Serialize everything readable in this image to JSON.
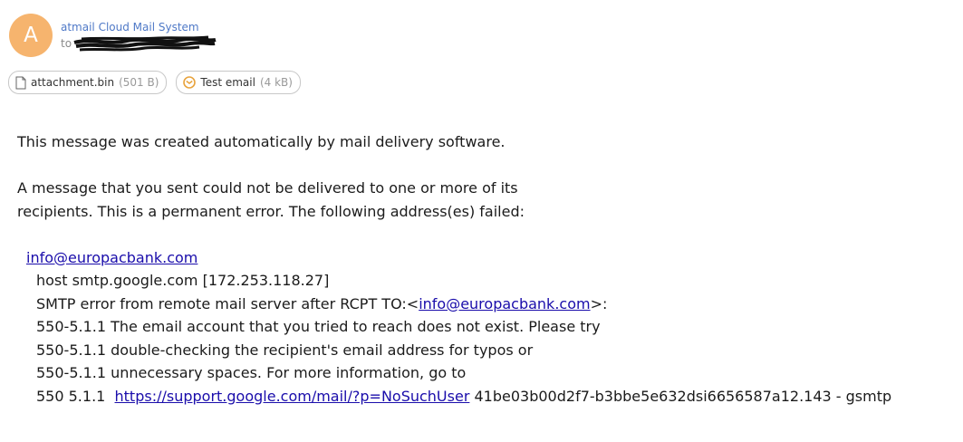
{
  "header": {
    "avatar_letter": "A",
    "sender_name": "atmail Cloud Mail System",
    "to_prefix": "to"
  },
  "attachments": [
    {
      "name": "attachment.bin",
      "size": "(501 B)",
      "icon": "file-icon"
    },
    {
      "name": "Test email",
      "size": "(4 kB)",
      "icon": "email-message-icon"
    }
  ],
  "message": {
    "line1": "This message was created automatically by mail delivery software.",
    "line2": "A message that you sent could not be delivered to one or more of its",
    "line3": "recipients. This is a permanent error. The following address(es) failed:",
    "failed_address": "info@europacbank.com",
    "host_line": "host smtp.google.com [172.253.118.27]",
    "smtp_prefix": "SMTP error from remote mail server after RCPT TO:<",
    "smtp_address": "info@europacbank.com",
    "smtp_suffix": ">:",
    "err1": "550-5.1.1 The email account that you tried to reach does not exist. Please try",
    "err2": "550-5.1.1 double-checking the recipient's email address for typos or",
    "err3": "550-5.1.1 unnecessary spaces. For more information, go to",
    "err4_prefix": "550 5.1.1  ",
    "err4_link": "https://support.google.com/mail/?p=NoSuchUser",
    "err4_suffix": " 41be03b00d2f7-b3bbe5e632dsi6656587a12.143 - gsmtp"
  },
  "colors": {
    "avatar": "#f6b46e",
    "sender": "#4f79c7",
    "link": "#1a0dab"
  }
}
